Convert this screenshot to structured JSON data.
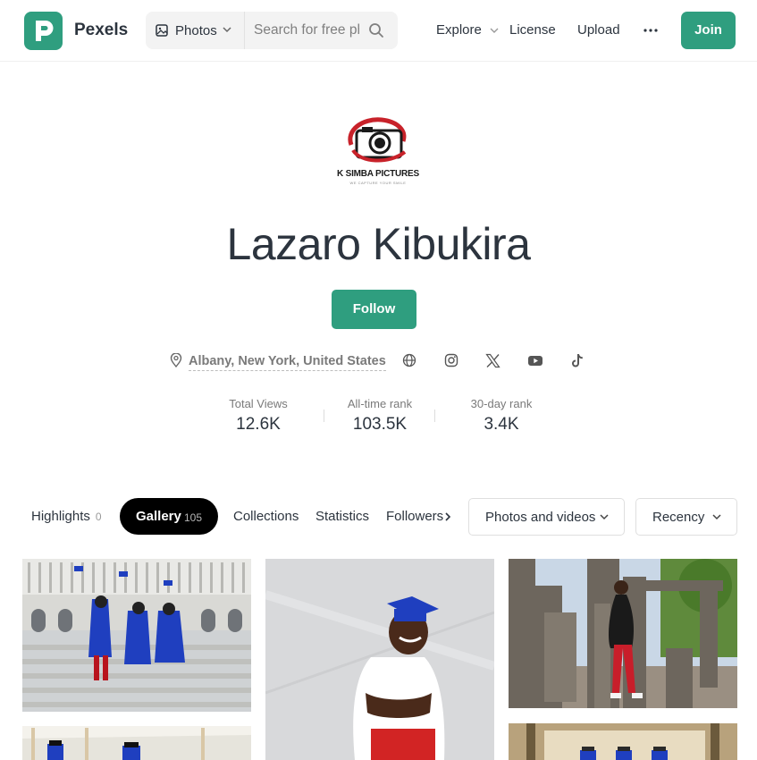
{
  "header": {
    "brand": "Pexels",
    "type_selector": "Photos",
    "search_placeholder": "Search for free photos",
    "nav": {
      "explore": "Explore",
      "license": "License",
      "upload": "Upload"
    },
    "join": "Join"
  },
  "profile": {
    "studio_logo_text": "K SIMBA PICTURES",
    "studio_tagline": "WE CAPTURE YOUR SMILE",
    "name": "Lazaro Kibukira",
    "follow": "Follow",
    "location": "Albany, New York, United States",
    "social_icons": [
      "globe-icon",
      "instagram-icon",
      "x-icon",
      "youtube-icon",
      "tiktok-icon"
    ]
  },
  "stats": [
    {
      "label": "Total Views",
      "value": "12.6K"
    },
    {
      "label": "All-time rank",
      "value": "103.5K"
    },
    {
      "label": "30-day rank",
      "value": "3.4K"
    }
  ],
  "tabs": {
    "highlights": {
      "label": "Highlights",
      "count": "0"
    },
    "gallery": {
      "label": "Gallery",
      "count": "105"
    },
    "collections": {
      "label": "Collections"
    },
    "statistics": {
      "label": "Statistics"
    },
    "followers": {
      "label": "Followers"
    }
  },
  "filters": {
    "media": "Photos and videos",
    "sort": "Recency"
  },
  "colors": {
    "brand_green": "#2f9e7f",
    "text_dark": "#2c343e",
    "muted": "#7a7a7a"
  }
}
